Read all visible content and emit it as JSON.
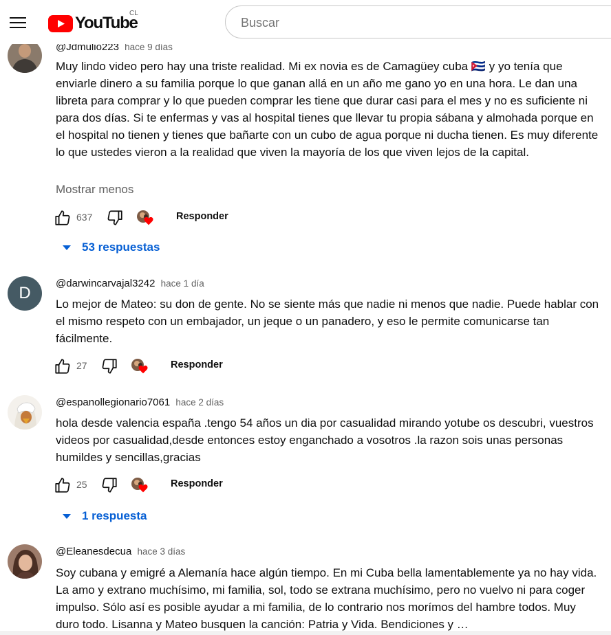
{
  "header": {
    "brand": "YouTube",
    "country": "CL",
    "search_placeholder": "Buscar"
  },
  "comments": [
    {
      "author": "@Jdmulio223",
      "time": "hace 9 días",
      "text": "Muy lindo video pero hay una triste realidad. Mi ex novia es de Camagüey cuba 🇨🇺 y yo tenía que enviarle dinero a su familia porque lo que ganan allá en un año me gano yo en una hora. Le dan una libreta para comprar y lo que pueden comprar les tiene que durar casi para el mes y no es suficiente ni para dos días. Si te enfermas y vas al hospital tienes que llevar tu propia sábana y almohada porque en el hospital no tienen y tienes que bañarte con un cubo de agua porque ni ducha tienen. Es muy diferente lo que ustedes vieron a la realidad que viven la mayoría de los que viven lejos de la capital.",
      "show_less": "Mostrar menos",
      "likes": "637",
      "reply_label": "Responder",
      "replies": "53 respuestas"
    },
    {
      "author": "@darwincarvajal3242",
      "time": "hace 1 día",
      "avatar_letter": "D",
      "text": "Lo mejor de Mateo: su don de gente. No se siente más que nadie ni menos que nadie. Puede hablar con el mismo respeto con un embajador, un jeque o un panadero, y eso le permite comunicarse tan fácilmente.",
      "likes": "27",
      "reply_label": "Responder"
    },
    {
      "author": "@espanollegionario7061",
      "time": "hace 2 días",
      "text": "hola desde valencia españa .tengo 54 años un dia por casualidad mirando yotube os descubri, vuestros videos por casualidad,desde entonces estoy enganchado a vosotros .la razon sois unas personas humildes y sencillas,gracias",
      "likes": "25",
      "reply_label": "Responder",
      "replies": "1 respuesta"
    },
    {
      "author": "@Eleanesdecua",
      "time": "hace 3 días",
      "text": "Soy cubana y emigré a Alemanía hace algún tiempo. En mi Cuba bella lamentablemente ya no hay vida. La amo y extrano muchísimo, mi familia, sol, todo se extrana muchísimo, pero no vuelvo ni para coger impulso. Sólo así es posible ayudar a mi familia, de lo contrario nos morímos del hambre todos. Muy duro todo. Lisanna y Mateo busquen la canción: Patria y Vida. Bendiciones y …"
    }
  ],
  "colors": {
    "brand_red": "#ff0000",
    "link_blue": "#065fd4",
    "heart_red": "#ff0000"
  },
  "icons": [
    "menu-icon",
    "youtube-logo-icon",
    "like-icon",
    "dislike-icon",
    "creator-heart-icon",
    "chevron-down-icon"
  ]
}
